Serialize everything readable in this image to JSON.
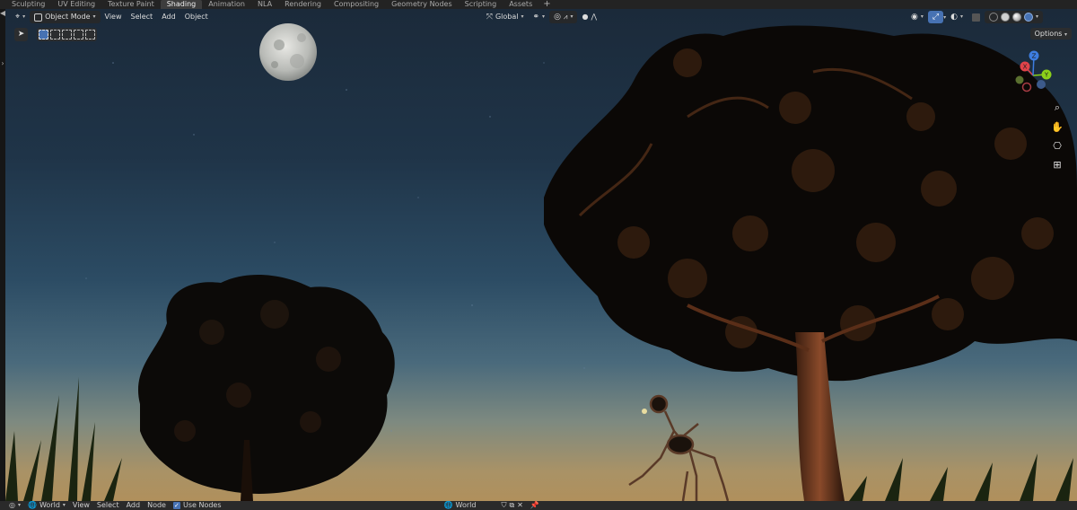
{
  "workspace_tabs": [
    {
      "label": "Sculpting",
      "active": false
    },
    {
      "label": "UV Editing",
      "active": false
    },
    {
      "label": "Texture Paint",
      "active": false
    },
    {
      "label": "Shading",
      "active": true
    },
    {
      "label": "Animation",
      "active": false
    },
    {
      "label": "NLA",
      "active": false
    },
    {
      "label": "Rendering",
      "active": false
    },
    {
      "label": "Compositing",
      "active": false
    },
    {
      "label": "Geometry Nodes",
      "active": false
    },
    {
      "label": "Scripting",
      "active": false
    },
    {
      "label": "Assets",
      "active": false
    }
  ],
  "add_tab_label": "+",
  "viewport_header": {
    "mode_label": "Object Mode",
    "menu": [
      "View",
      "Select",
      "Add",
      "Object"
    ],
    "orientation_label": "Global",
    "options_label": "Options"
  },
  "gizmo": {
    "x_label": "X",
    "y_label": "Y",
    "z_label": "Z"
  },
  "bottom_bar": {
    "context_label": "World",
    "menu": [
      "View",
      "Select",
      "Add",
      "Node"
    ],
    "use_nodes_label": "Use Nodes",
    "world_name": "World"
  },
  "colors": {
    "accent": "#4772b3",
    "tab_active": "#3d3d3d",
    "axis_x": "#e0434a",
    "axis_y": "#8bd11a",
    "axis_z": "#3d7de0"
  },
  "icons": [
    "editor-type-icon",
    "object-mode-icon",
    "transform-pivot-icon",
    "snap-icon",
    "proportional-edit-icon",
    "visibility-icon",
    "gizmo-icon",
    "overlay-icon",
    "xray-icon",
    "shading-wireframe-icon",
    "shading-solid-icon",
    "shading-material-icon",
    "shading-rendered-icon",
    "zoom-icon",
    "hand-icon",
    "camera-icon",
    "grid-icon",
    "world-icon",
    "pin-icon"
  ]
}
